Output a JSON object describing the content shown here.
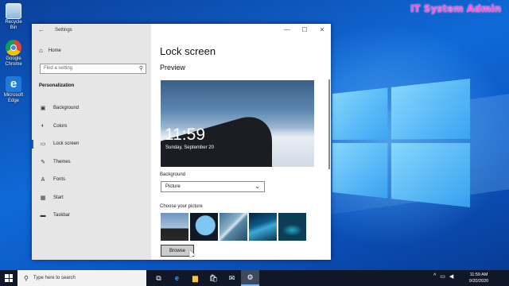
{
  "desktop": {
    "watermark": "IT System Admin",
    "icons": [
      {
        "label": "Recycle Bin",
        "icon": "recycle-bin-icon"
      },
      {
        "label": "Google Chrome",
        "icon": "chrome-icon"
      },
      {
        "label": "Microsoft Edge",
        "icon": "edge-icon"
      }
    ]
  },
  "window": {
    "title": "Settings",
    "controls": {
      "minimize": "—",
      "maximize": "☐",
      "close": "✕"
    }
  },
  "sidebar": {
    "home_label": "Home",
    "search_placeholder": "Find a setting",
    "section_title": "Personalization",
    "items": [
      {
        "label": "Background",
        "icon": "picture-icon"
      },
      {
        "label": "Colors",
        "icon": "palette-icon"
      },
      {
        "label": "Lock screen",
        "icon": "lock-screen-icon",
        "active": true
      },
      {
        "label": "Themes",
        "icon": "brush-icon"
      },
      {
        "label": "Fonts",
        "icon": "font-icon"
      },
      {
        "label": "Start",
        "icon": "start-icon"
      },
      {
        "label": "Taskbar",
        "icon": "taskbar-icon"
      }
    ]
  },
  "main": {
    "title": "Lock screen",
    "preview_heading": "Preview",
    "preview_time": "11:59",
    "preview_date": "Sunday, September 20",
    "background_label": "Background",
    "background_value": "Picture",
    "choose_picture_label": "Choose your picture",
    "browse_label": "Browse"
  },
  "taskbar": {
    "search_placeholder": "Type here to search",
    "time": "11:59 AM",
    "date": "9/20/2020",
    "accent": "#7fb4ff"
  }
}
